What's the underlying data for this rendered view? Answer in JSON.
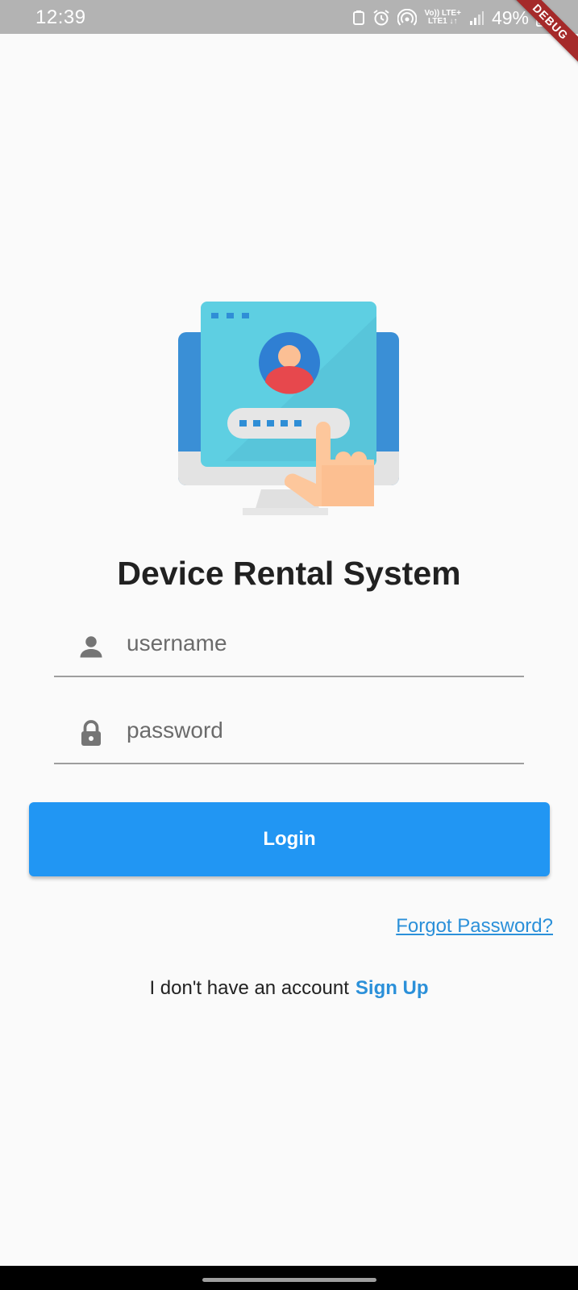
{
  "status_bar": {
    "time": "12:39",
    "network_top": "Vo)) LTE+",
    "network_bottom": "LTE1 ↓↑",
    "battery": "49%"
  },
  "debug_banner": "DEBUG",
  "illustration": {
    "icon": "computer-login-illustration"
  },
  "title": "Device Rental System",
  "form": {
    "username_placeholder": "username",
    "username_icon": "person-icon",
    "password_placeholder": "password",
    "password_icon": "lock-icon",
    "login_label": "Login"
  },
  "forgot_password": "Forgot Password?",
  "signup": {
    "prompt": "I don't have an account",
    "link": "Sign Up"
  },
  "colors": {
    "primary": "#2196f3",
    "link": "#2b90d9",
    "status_bar": "#b3b3b3",
    "debug_ribbon": "#a52a2a"
  }
}
